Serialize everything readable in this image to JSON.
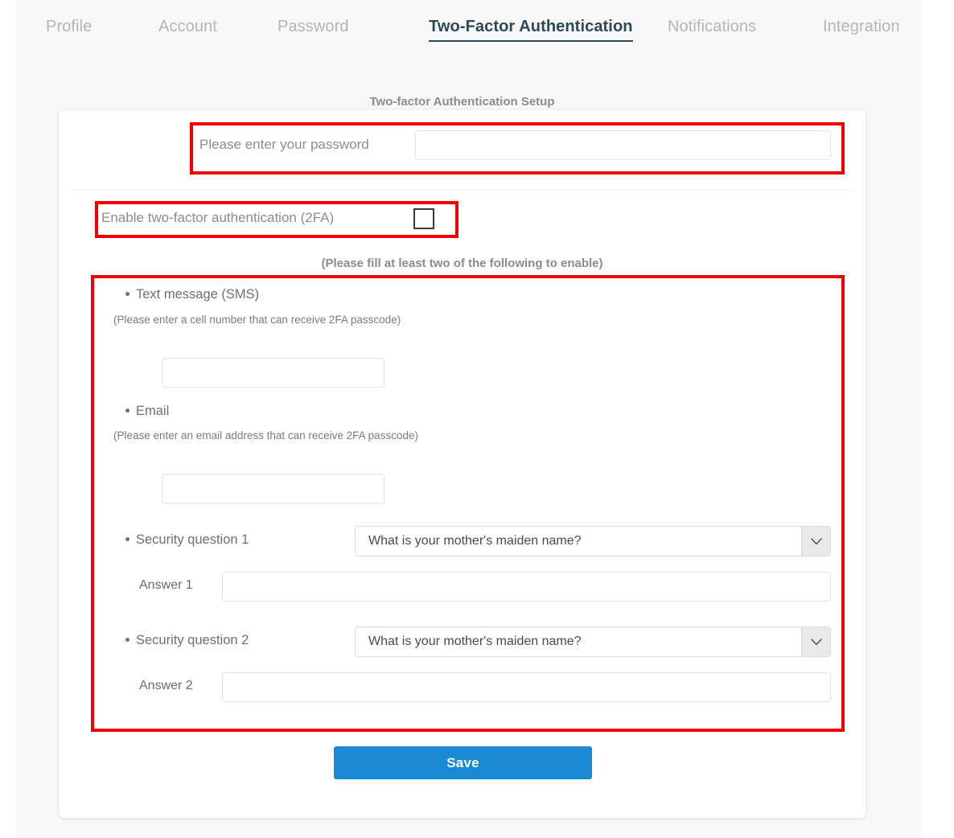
{
  "tabs": [
    {
      "label": "Profile",
      "active": false
    },
    {
      "label": "Account",
      "active": false
    },
    {
      "label": "Password",
      "active": false
    },
    {
      "label": "Two-Factor Authentication",
      "active": true
    },
    {
      "label": "Notifications",
      "active": false
    },
    {
      "label": "Integration",
      "active": false
    }
  ],
  "card": {
    "title": "Two-factor Authentication Setup",
    "password": {
      "label": "Please enter your password",
      "value": "",
      "placeholder": ""
    },
    "enable_2fa": {
      "label": "Enable two-factor authentication (2FA)",
      "checked": false
    },
    "fill_note": "(Please fill at least two of the following to enable)",
    "sms": {
      "label": "Text message (SMS)",
      "hint": "(Please enter a cell number that can receive 2FA passcode)",
      "value": "",
      "placeholder": ""
    },
    "email": {
      "label": "Email",
      "hint": "(Please enter an email address that can receive 2FA passcode)",
      "value": "",
      "placeholder": ""
    },
    "security_question_1": {
      "label": "Security question 1",
      "selected": "What is your mother's maiden name?",
      "answer_label": "Answer 1",
      "answer_value": "",
      "answer_placeholder": ""
    },
    "security_question_2": {
      "label": "Security question 2",
      "selected": "What is your mother's maiden name?",
      "answer_label": "Answer 2",
      "answer_value": "",
      "answer_placeholder": ""
    },
    "save_label": "Save"
  },
  "colors": {
    "accent": "#1b8ad4",
    "active_tab": "#2f4858",
    "inactive_tab": "#b5b5b5",
    "annotation": "#f20000",
    "page_bg": "#f8f8f8"
  }
}
